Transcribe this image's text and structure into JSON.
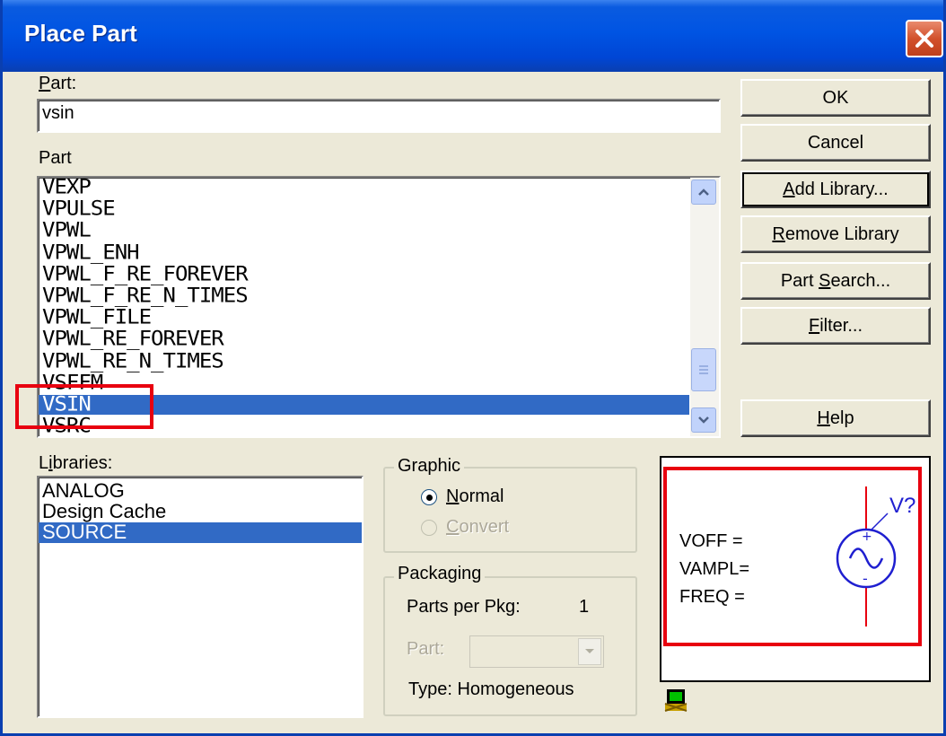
{
  "window": {
    "title": "Place Part",
    "close_icon": "close-icon"
  },
  "part_field": {
    "label_prefix": "P",
    "label_rest": "art:",
    "value": "vsin"
  },
  "part_list": {
    "label": "Part",
    "items": [
      "VEXP",
      "VPULSE",
      "VPWL",
      "VPWL_ENH",
      "VPWL_F_RE_FOREVER",
      "VPWL_F_RE_N_TIMES",
      "VPWL_FILE",
      "VPWL_RE_FOREVER",
      "VPWL_RE_N_TIMES",
      "VSFFM",
      "VSIN",
      "VSRC"
    ],
    "selected": "VSIN"
  },
  "buttons": {
    "ok": "OK",
    "cancel": "Cancel",
    "add_library_u": "A",
    "add_library_rest": "dd Library...",
    "remove_library_u": "R",
    "remove_library_rest": "emove Library",
    "part_search_pre": "Part ",
    "part_search_u": "S",
    "part_search_rest": "earch...",
    "filter_u": "F",
    "filter_rest": "ilter...",
    "help_u": "H",
    "help_rest": "elp"
  },
  "libraries": {
    "label_pre": "L",
    "label_u": "i",
    "label_rest": "braries:",
    "items": [
      "ANALOG",
      "Design Cache",
      "SOURCE"
    ],
    "selected": "SOURCE"
  },
  "graphic": {
    "title": "Graphic",
    "normal_u": "N",
    "normal_rest": "ormal",
    "convert_u": "C",
    "convert_rest": "onvert",
    "selected": "Normal"
  },
  "packaging": {
    "title": "Packaging",
    "parts_per_pkg_label": "Parts per Pkg:",
    "parts_per_pkg_value": "1",
    "part_label": "Part:",
    "type_label": "Type: Homogeneous"
  },
  "preview": {
    "attributes": [
      "VOFF =",
      "VAMPL=",
      "FREQ ="
    ],
    "ref_label": "V?",
    "symbol_color": "#1f1fd0",
    "wire_color": "#e8000f"
  },
  "annotation_color": "#e8000f"
}
